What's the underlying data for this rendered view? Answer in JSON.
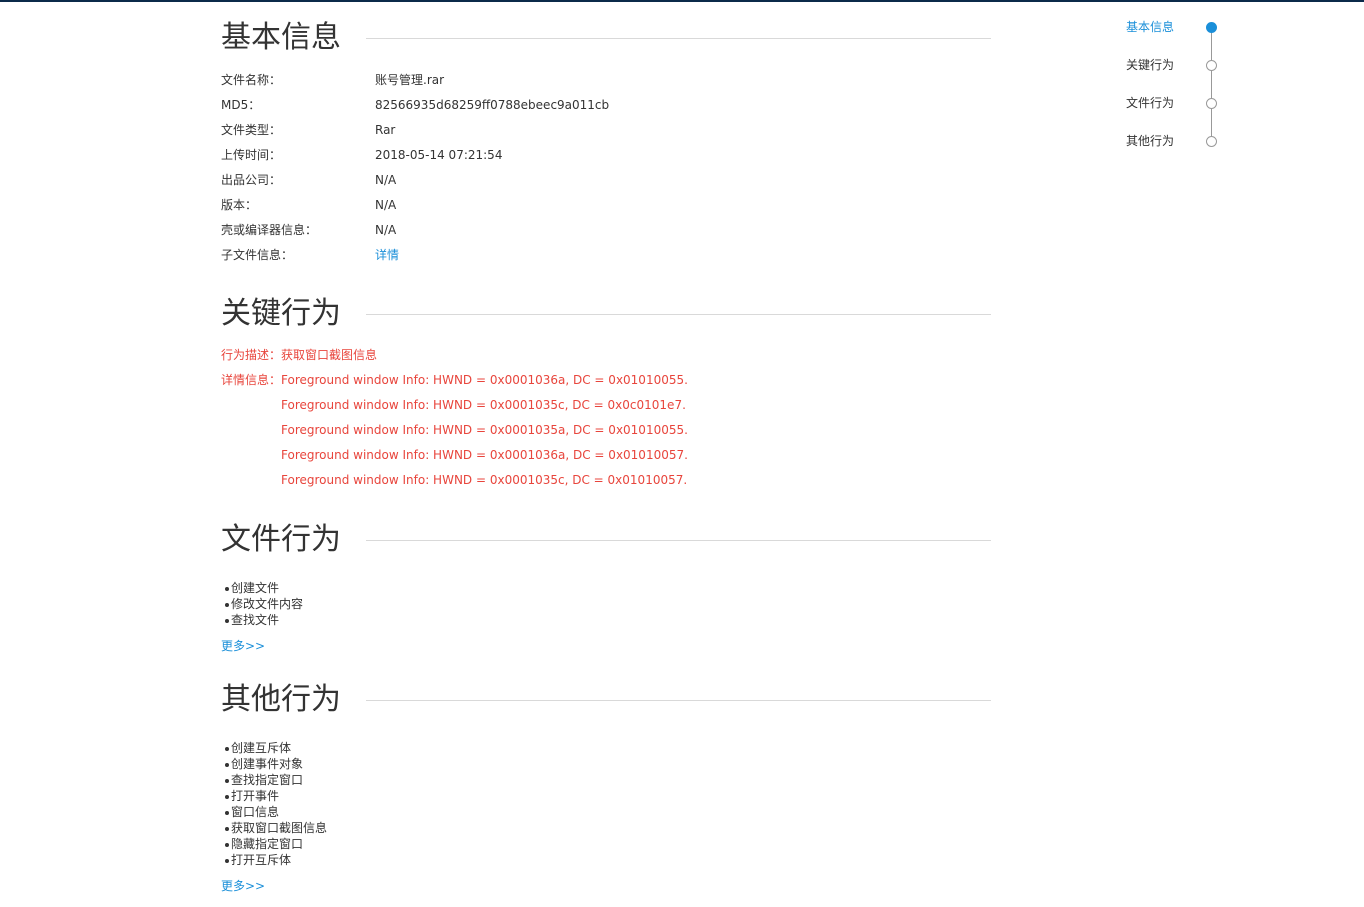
{
  "basic_info": {
    "title": "基本信息",
    "rows": [
      {
        "label": "文件名称：",
        "value": "账号管理.rar"
      },
      {
        "label": "MD5：",
        "value": "82566935d68259ff0788ebeec9a011cb"
      },
      {
        "label": "文件类型：",
        "value": "Rar"
      },
      {
        "label": "上传时间：",
        "value": "2018-05-14 07:21:54"
      },
      {
        "label": "出品公司：",
        "value": "N/A"
      },
      {
        "label": "版本：",
        "value": "N/A"
      },
      {
        "label": "壳或编译器信息：",
        "value": "N/A"
      },
      {
        "label": "子文件信息：",
        "value": "详情"
      }
    ]
  },
  "key_behavior": {
    "title": "关键行为",
    "desc_label": "行为描述：",
    "desc_value": "获取窗口截图信息",
    "detail_label": "详情信息：",
    "details": [
      "Foreground window Info: HWND = 0x0001036a, DC = 0x01010055.",
      "Foreground window Info: HWND = 0x0001035c, DC = 0x0c0101e7.",
      "Foreground window Info: HWND = 0x0001035a, DC = 0x01010055.",
      "Foreground window Info: HWND = 0x0001036a, DC = 0x01010057.",
      "Foreground window Info: HWND = 0x0001035c, DC = 0x01010057."
    ]
  },
  "file_behavior": {
    "title": "文件行为",
    "items": [
      "创建文件",
      "修改文件内容",
      "查找文件"
    ],
    "more": "更多>>"
  },
  "other_behavior": {
    "title": "其他行为",
    "items": [
      "创建互斥体",
      "创建事件对象",
      "查找指定窗口",
      "打开事件",
      "窗口信息",
      "获取窗口截图信息",
      "隐藏指定窗口",
      "打开互斥体"
    ],
    "more": "更多>>"
  },
  "sidenav": {
    "items": [
      {
        "label": "基本信息",
        "active": true
      },
      {
        "label": "关键行为",
        "active": false
      },
      {
        "label": "文件行为",
        "active": false
      },
      {
        "label": "其他行为",
        "active": false
      }
    ]
  },
  "colors": {
    "accent": "#1a8fd9",
    "alert": "#e8453c",
    "text": "#333333",
    "divider": "#d9d9d9"
  }
}
